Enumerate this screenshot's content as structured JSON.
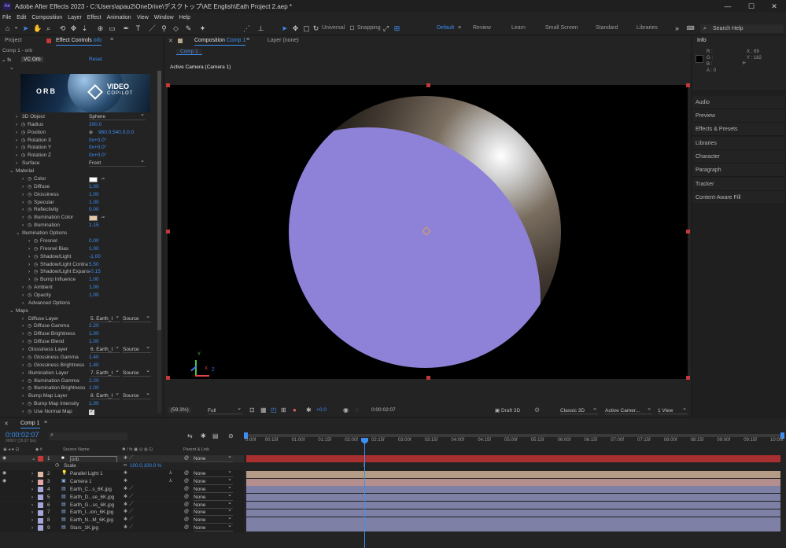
{
  "app": {
    "title": "Adobe After Effects 2023 - C:\\Users\\apau2\\OneDrive\\デスクトップ\\AE English\\Eath Project 2.aep *",
    "logo": "Ae"
  },
  "window_controls": {
    "minimize": "—",
    "maximize": "☐",
    "close": "✕"
  },
  "menu": [
    "File",
    "Edit",
    "Composition",
    "Layer",
    "Effect",
    "Animation",
    "View",
    "Window",
    "Help"
  ],
  "toolbar": {
    "universal": "Universal",
    "snapping": "Snapping",
    "workspaces": [
      "Default",
      "Review",
      "Learn",
      "Small Screen",
      "Standard",
      "Libraries"
    ],
    "active_workspace": "Default",
    "search_placeholder": "Search Help"
  },
  "left_panel": {
    "tab_project": "Project",
    "tab_effect_controls": "Effect Controls",
    "tab_effect_target": "orb",
    "breadcrumb": "Comp 1 - orb",
    "effect_name": "VC Orb",
    "reset": "Reset",
    "banner_left": "ORB",
    "banner_brand_top": "VIDEO",
    "banner_brand_bottom": "COPILOT",
    "properties": [
      {
        "label": "3D Object",
        "value": "Sphere",
        "kind": "dropdown",
        "indent": 1
      },
      {
        "label": "Radius",
        "value": "200.0",
        "kind": "value",
        "indent": 1
      },
      {
        "label": "Position",
        "value": "960.0,540.0,0.0",
        "kind": "value",
        "indent": 1
      },
      {
        "label": "Rotation X",
        "value": "0x+0.0°",
        "kind": "value",
        "indent": 1
      },
      {
        "label": "Rotation Y",
        "value": "0x+0.0°",
        "kind": "value",
        "indent": 1
      },
      {
        "label": "Rotation Z",
        "value": "0x+0.0°",
        "kind": "value",
        "indent": 1
      },
      {
        "label": "Surface",
        "value": "Front",
        "kind": "dropdown",
        "indent": 1
      },
      {
        "label": "Material",
        "value": "",
        "kind": "group",
        "indent": 0
      },
      {
        "label": "Color",
        "value": "",
        "kind": "color",
        "indent": 2,
        "color": "#ffffff"
      },
      {
        "label": "Diffuse",
        "value": "1.00",
        "kind": "value",
        "indent": 2
      },
      {
        "label": "Glossiness",
        "value": "1.00",
        "kind": "value",
        "indent": 2
      },
      {
        "label": "Specular",
        "value": "1.00",
        "kind": "value",
        "indent": 2
      },
      {
        "label": "Reflectivity",
        "value": "0.00",
        "kind": "value",
        "indent": 2
      },
      {
        "label": "Illumination Color",
        "value": "",
        "kind": "color",
        "indent": 2,
        "color": "#e8c9a2"
      },
      {
        "label": "Illumination",
        "value": "1.15",
        "kind": "value",
        "indent": 2
      },
      {
        "label": "Illumination Options",
        "value": "",
        "kind": "group",
        "indent": 1
      },
      {
        "label": "Fresnel",
        "value": "0.00",
        "kind": "value",
        "indent": 3
      },
      {
        "label": "Fresnel Bias",
        "value": "1.00",
        "kind": "value",
        "indent": 3
      },
      {
        "label": "Shadow/Light",
        "value": "-1.00",
        "kind": "value",
        "indent": 3
      },
      {
        "label": "Shadow/Light Contra",
        "value": "5.50",
        "kind": "value",
        "indent": 3
      },
      {
        "label": "Shadow/Light Expans",
        "value": "-0.15",
        "kind": "value",
        "indent": 3
      },
      {
        "label": "Bump Influence",
        "value": "1.00",
        "kind": "value",
        "indent": 3
      },
      {
        "label": "Ambient",
        "value": "1.00",
        "kind": "value",
        "indent": 2
      },
      {
        "label": "Opacity",
        "value": "1.00",
        "kind": "value",
        "indent": 2
      },
      {
        "label": "Advanced Options",
        "value": "",
        "kind": "sub",
        "indent": 2
      },
      {
        "label": "Maps",
        "value": "",
        "kind": "group",
        "indent": 0
      },
      {
        "label": "Diffuse Layer",
        "value": "5. Earth_I",
        "value2": "Source",
        "kind": "layer",
        "indent": 2
      },
      {
        "label": "Diffuse Gamma",
        "value": "2.20",
        "kind": "value",
        "indent": 2
      },
      {
        "label": "Diffuse Brightness",
        "value": "1.00",
        "kind": "value",
        "indent": 2
      },
      {
        "label": "Diffuse Blend",
        "value": "1.00",
        "kind": "value",
        "indent": 2
      },
      {
        "label": "Glossiness Layer",
        "value": "6. Earth_I",
        "value2": "Source",
        "kind": "layer",
        "indent": 2
      },
      {
        "label": "Glossiness Gamma",
        "value": "1.40",
        "kind": "value",
        "indent": 2
      },
      {
        "label": "Glossiness Brightness",
        "value": "1.40",
        "kind": "value",
        "indent": 2
      },
      {
        "label": "Illumination Layer",
        "value": "7. Earth_I",
        "value2": "Source",
        "kind": "layer",
        "indent": 2
      },
      {
        "label": "Illumination Gamma",
        "value": "2.20",
        "kind": "value",
        "indent": 2
      },
      {
        "label": "Illumination Brightness",
        "value": "1.00",
        "kind": "value",
        "indent": 2
      },
      {
        "label": "Bump Map Layer",
        "value": "8. Earth_I",
        "value2": "Source",
        "kind": "layer",
        "indent": 2
      },
      {
        "label": "Bump Map Intensity",
        "value": "1.00",
        "kind": "value",
        "indent": 2
      },
      {
        "label": "Use Normal Map",
        "value": "",
        "kind": "checkbox",
        "indent": 2
      }
    ]
  },
  "composition_panel": {
    "tab_label": "Composition",
    "tab_target": "Comp 1",
    "layer_tab": "Layer (none)",
    "subtab": "Comp 1",
    "camera_label": "Active Camera (Camera 1)",
    "axis_x": "X",
    "axis_y": "Y",
    "axis_z": "Z",
    "zoom": "(59.3%)",
    "resolution": "Full",
    "exposure": "+0.0",
    "timecode": "0:00:02:07",
    "draft3d": "Draft 3D",
    "renderer": "Classic 3D",
    "camera": "Active Camer...",
    "views": "1 View"
  },
  "info_panel": {
    "title": "Info",
    "r": "R :",
    "g": "G :",
    "b": "B :",
    "a": "A : 0",
    "x": "X : 69",
    "y": "Y : 182"
  },
  "right_panels": [
    "Audio",
    "Preview",
    "Effects & Presets",
    "Libraries",
    "Character",
    "Paragraph",
    "Tracker",
    "Content-Aware Fill"
  ],
  "timeline": {
    "tab": "Comp 1",
    "timecode": "0:00:02:07",
    "frame_info": "00067 (29.97 fps)",
    "search_placeholder": "",
    "col_source": "Source Name",
    "col_parent": "Parent & Link",
    "ruler": [
      "0:00f",
      "00:15f",
      "01:00f",
      "01:15f",
      "02:00f",
      "02:15f",
      "03:00f",
      "03:15f",
      "04:00f",
      "04:15f",
      "05:00f",
      "05:15f",
      "06:00f",
      "06:15f",
      "07:00f",
      "07:15f",
      "08:00f",
      "08:15f",
      "09:00f",
      "09:15f",
      "10:00f"
    ],
    "scale_label": "Scale",
    "scale_value": "100.0,100.0 %",
    "layers": [
      {
        "num": "1",
        "name": "orb",
        "parent": "None",
        "label_color": "#c43838",
        "bar": "#a82f2f",
        "type": "solid"
      },
      {
        "num": "2",
        "name": "Parallel Light 1",
        "parent": "None",
        "label_color": "#e0b7a0",
        "bar": "#b39b86",
        "type": "light"
      },
      {
        "num": "3",
        "name": "Camera 1",
        "parent": "None",
        "label_color": "#e4a6a6",
        "bar": "#b58e8e",
        "type": "camera"
      },
      {
        "num": "4",
        "name": "Earth_C...s_6K.jpg",
        "parent": "None",
        "label_color": "#a6a7d8",
        "bar": "#7e80a6",
        "type": "image"
      },
      {
        "num": "5",
        "name": "Earth_D...se_6K.jpg",
        "parent": "None",
        "label_color": "#a6a7d8",
        "bar": "#7e80a6",
        "type": "image"
      },
      {
        "num": "6",
        "name": "Earth_G...ss_6K.jpg",
        "parent": "None",
        "label_color": "#a6a7d8",
        "bar": "#7e80a6",
        "type": "image"
      },
      {
        "num": "7",
        "name": "Earth_I...ion_6K.jpg",
        "parent": "None",
        "label_color": "#a6a7d8",
        "bar": "#7e80a6",
        "type": "image"
      },
      {
        "num": "8",
        "name": "Earth_N...M_6K.jpg",
        "parent": "None",
        "label_color": "#a6a7d8",
        "bar": "#7e80a6",
        "type": "image"
      },
      {
        "num": "9",
        "name": "Stars_1K.jpg",
        "parent": "None",
        "label_color": "#a6a7d8",
        "bar": "#7e80a6",
        "type": "image"
      }
    ],
    "playhead_fraction": 0.2244
  },
  "colors": {
    "accent": "#3c8ff4",
    "panel": "#232323",
    "dark": "#1d1d1d",
    "viewer_bg": "#000000",
    "purple": "#8e82d8"
  }
}
